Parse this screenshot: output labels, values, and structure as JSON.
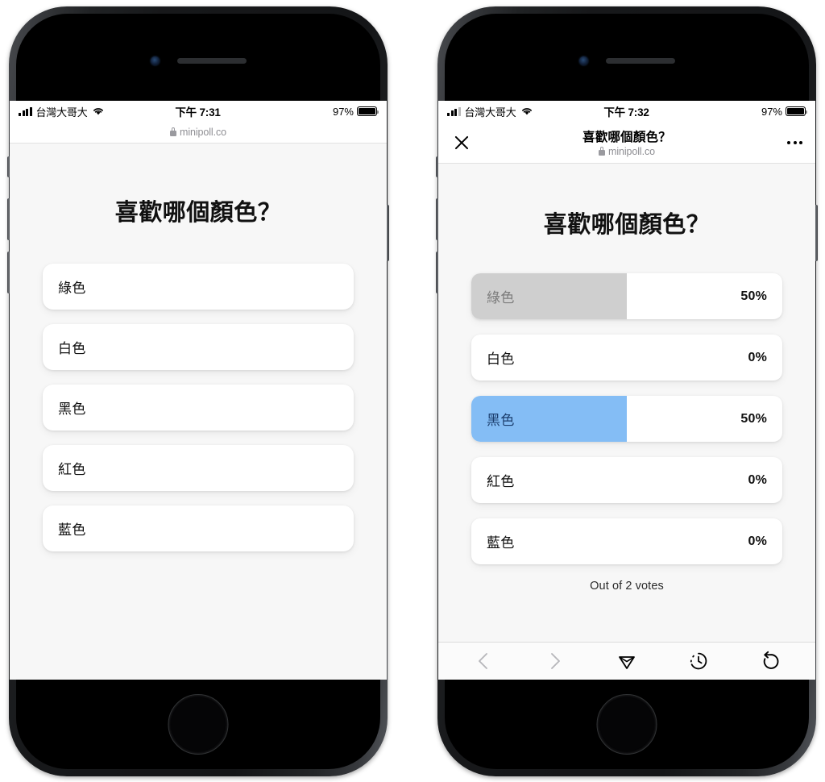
{
  "phones": [
    {
      "id": "vote",
      "status_bar": {
        "carrier": "台灣大哥大",
        "time": "下午 7:31",
        "battery_pct": "97%",
        "signal_icon": "cellular-bars-icon",
        "wifi_icon": "wifi-icon",
        "battery_icon": "battery-icon"
      },
      "browser": {
        "url": "minipoll.co",
        "lock_icon": "lock-icon"
      },
      "poll": {
        "title": "喜歡哪個顏色？",
        "options": [
          {
            "label": "綠色"
          },
          {
            "label": "白色"
          },
          {
            "label": "黑色"
          },
          {
            "label": "紅色"
          },
          {
            "label": "藍色"
          }
        ]
      }
    },
    {
      "id": "result",
      "status_bar": {
        "carrier": "台灣大哥大",
        "time": "下午 7:32",
        "battery_pct": "97%",
        "signal_icon": "cellular-bars-icon",
        "wifi_icon": "wifi-icon",
        "battery_icon": "battery-icon"
      },
      "browser": {
        "title": "喜歡哪個顏色？",
        "url": "minipoll.co",
        "lock_icon": "lock-icon",
        "close_icon": "close-icon",
        "menu_icon": "more-options-icon"
      },
      "poll": {
        "title": "喜歡哪個顏色？",
        "votes_note": "Out of 2 votes",
        "results": [
          {
            "label": "綠色",
            "pct": "50%",
            "value": 50,
            "state": "gray"
          },
          {
            "label": "白色",
            "pct": "0%",
            "value": 0,
            "state": "plain"
          },
          {
            "label": "黑色",
            "pct": "50%",
            "value": 50,
            "state": "blue"
          },
          {
            "label": "紅色",
            "pct": "0%",
            "value": 0,
            "state": "plain"
          },
          {
            "label": "藍色",
            "pct": "0%",
            "value": 0,
            "state": "plain"
          }
        ]
      },
      "toolbar": {
        "items": [
          {
            "icon": "back-chevron-icon",
            "enabled": false
          },
          {
            "icon": "forward-chevron-icon",
            "enabled": false
          },
          {
            "icon": "share-icon",
            "enabled": true
          },
          {
            "icon": "history-clock-icon",
            "enabled": true
          },
          {
            "icon": "reload-icon",
            "enabled": true
          }
        ]
      }
    }
  ],
  "chart_data": {
    "type": "bar",
    "title": "喜歡哪個顏色？",
    "categories": [
      "綠色",
      "白色",
      "黑色",
      "紅色",
      "藍色"
    ],
    "values": [
      50,
      0,
      50,
      0,
      0
    ],
    "unit": "%",
    "total_votes": 2,
    "annotation": "Out of 2 votes",
    "colors": {
      "gray_fill": "#cfcfcf",
      "blue_fill": "#84bdf5",
      "track": "#ffffff"
    },
    "xlabel": "",
    "ylabel": "",
    "ylim": [
      0,
      100
    ],
    "legend": false,
    "grid": false
  },
  "theme": {
    "page_bg": "#f7f7f7",
    "card_bg": "#ffffff",
    "accent_blue": "#84bdf5",
    "selected_text": "#1d3f6e",
    "muted_gray": "#8e8e93"
  }
}
